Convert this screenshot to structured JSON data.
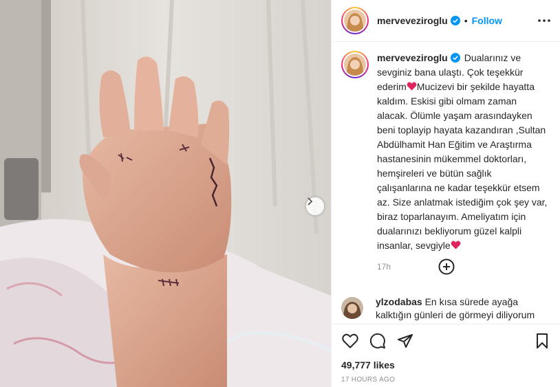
{
  "post": {
    "username": "merveveziroglu",
    "follow_label": "Follow",
    "separator": "•",
    "caption": "Dualarınız ve sevginiz bana ulaştı. Çok teşekkür ederim",
    "caption_2": "Mucizevi bir şekilde hayatta kaldım. Eskisi gibi olmam zaman alacak. Ölümle yaşam arasındayken beni toplayip hayata kazandıran ,Sultan Abdülhamit Han Eğitim ve Araştırma hastanesinin mükemmel doktorları, hemşireleri ve bütün sağlık çalışanlarına ne kadar teşekkür etsem az. Size anlatmak istediğim çok şey var, biraz toparlanayım. Ameliyatım için dualarınızı bekliyorum güzel kalpli insanlar, sevgiyle",
    "caption_time": "17h",
    "likes": "49,777 likes",
    "date": "17 HOURS AGO"
  },
  "comments": [
    {
      "username": "ylzodabas",
      "text": "En kısa sürede ayağa kalktığın günleri de görmeyi diliyorum"
    }
  ],
  "icons": {
    "verified": "verified-badge-icon",
    "more": "more-options-icon",
    "heart_emoji": "red-heart-emoji",
    "load_more": "plus-circle-icon",
    "like": "heart-outline-icon",
    "comment": "comment-bubble-icon",
    "share": "paper-plane-icon",
    "save": "bookmark-icon",
    "next": "chevron-right-icon"
  },
  "colors": {
    "accent": "#0095f6",
    "verified": "#0095f6",
    "heart": "#e0245e",
    "muted": "#8e8e8e"
  }
}
